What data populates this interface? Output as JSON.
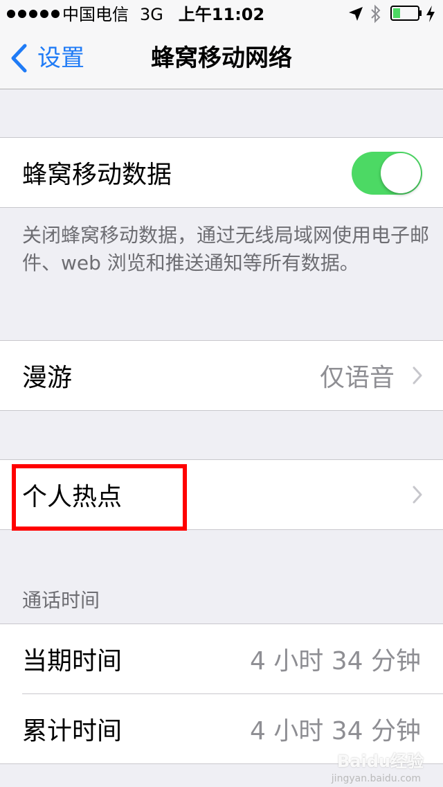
{
  "status_bar": {
    "carrier": "中国电信",
    "network": "3G",
    "time": "上午11:02",
    "location_icon": "location-arrow-icon",
    "bluetooth_icon": "bluetooth-icon",
    "battery_icon": "battery-icon",
    "battery_level": 0.3,
    "charging_icon": "charging-bolt-icon"
  },
  "nav": {
    "back_label": "设置",
    "title": "蜂窝移动网络"
  },
  "cellular_data": {
    "label": "蜂窝移动数据",
    "enabled": true,
    "footer": "关闭蜂窝移动数据，通过无线局域网使用电子邮件、web 浏览和推送通知等所有数据。"
  },
  "roaming": {
    "label": "漫游",
    "value": "仅语音"
  },
  "hotspot": {
    "label": "个人热点"
  },
  "call_time": {
    "header": "通话时间",
    "rows": [
      {
        "label": "当期时间",
        "value": "4 小时 34 分钟"
      },
      {
        "label": "累计时间",
        "value": "4 小时 34 分钟"
      }
    ]
  },
  "colors": {
    "accent": "#1f7bf6",
    "toggle_on": "#4cd964",
    "highlight": "#ff0000",
    "background": "#efeff4"
  },
  "watermark": {
    "text": "Baidu经验",
    "sub": "jingyan.baidu.com"
  }
}
